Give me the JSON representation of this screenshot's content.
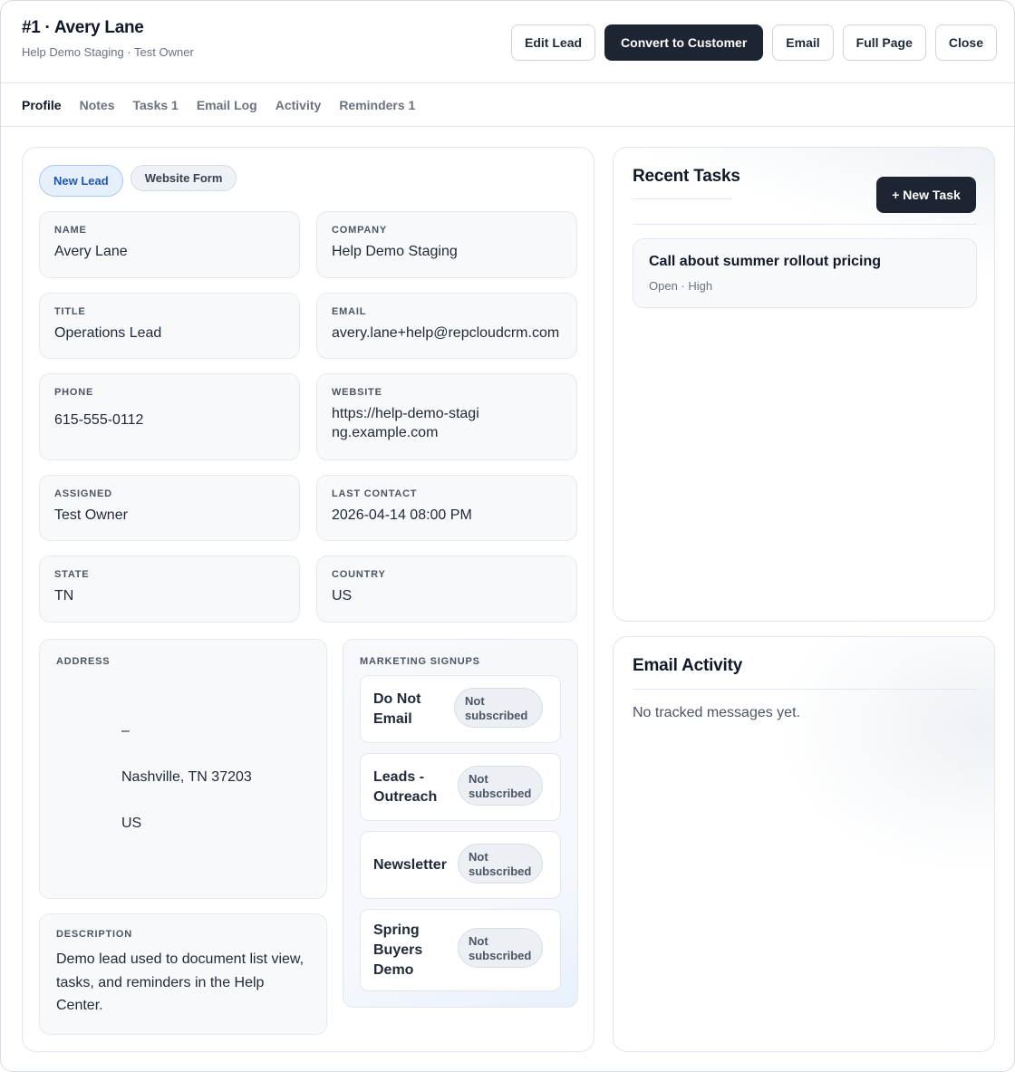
{
  "header": {
    "title": "#1 · Avery Lane",
    "subtitle": "Help Demo Staging · Test Owner",
    "actions": {
      "edit": "Edit Lead",
      "convert": "Convert to Customer",
      "email": "Email",
      "full_page": "Full Page",
      "close": "Close"
    }
  },
  "tabs": [
    {
      "label": "Profile",
      "active": true
    },
    {
      "label": "Notes"
    },
    {
      "label": "Tasks 1"
    },
    {
      "label": "Email Log"
    },
    {
      "label": "Activity"
    },
    {
      "label": "Reminders 1"
    }
  ],
  "badges": {
    "status": "New Lead",
    "source": "Website Form"
  },
  "fields": {
    "name": {
      "label": "NAME",
      "value": "Avery Lane"
    },
    "company": {
      "label": "COMPANY",
      "value": "Help Demo Staging"
    },
    "title": {
      "label": "TITLE",
      "value": "Operations Lead"
    },
    "email": {
      "label": "EMAIL",
      "value": "avery.lane+help@repcloudcrm.com"
    },
    "phone": {
      "label": "PHONE",
      "value": "615-555-0112"
    },
    "website": {
      "label": "WEBSITE",
      "value": "https://help-demo-staging.example.com"
    },
    "assigned": {
      "label": "ASSIGNED",
      "value": "Test Owner"
    },
    "last_contact": {
      "label": "LAST CONTACT",
      "value": "2026-04-14 08:00 PM"
    },
    "state": {
      "label": "STATE",
      "value": "TN"
    },
    "country": {
      "label": "COUNTRY",
      "value": "US"
    }
  },
  "address": {
    "label": "ADDRESS",
    "lines": [
      "–",
      "Nashville, TN 37203",
      "US"
    ]
  },
  "description": {
    "label": "DESCRIPTION",
    "value": "Demo lead used to document list view, tasks, and reminders in the Help Center."
  },
  "marketing": {
    "label": "MARKETING SIGNUPS",
    "items": [
      {
        "name": "Do Not Email",
        "status": "Not subscribed"
      },
      {
        "name": "Leads - Outreach",
        "status": "Not subscribed"
      },
      {
        "name": "Newsletter",
        "status": "Not subscribed"
      },
      {
        "name": "Spring Buyers Demo",
        "status": "Not subscribed"
      }
    ]
  },
  "recent_tasks": {
    "title": "Recent Tasks",
    "new_button": "+ New Task",
    "items": [
      {
        "title": "Call about summer rollout pricing",
        "meta": "Open · High"
      }
    ]
  },
  "email_activity": {
    "title": "Email Activity",
    "empty": "No tracked messages yet."
  },
  "colors": {
    "primary_dark": "#1e2532",
    "badge_blue": "#1f57b8",
    "muted": "#6b7280"
  }
}
